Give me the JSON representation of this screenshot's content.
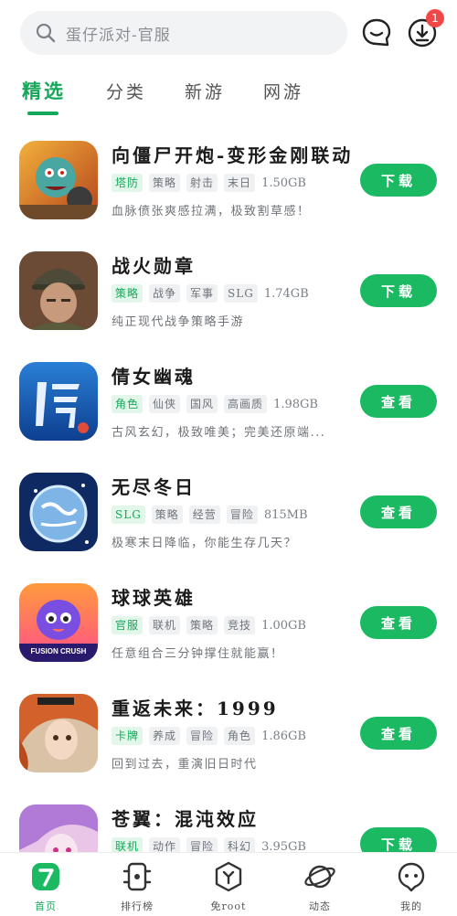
{
  "search": {
    "placeholder": "蛋仔派对-官服"
  },
  "header": {
    "download_badge": "1"
  },
  "tabs": [
    {
      "label": "精选",
      "active": true
    },
    {
      "label": "分类",
      "active": false
    },
    {
      "label": "新游",
      "active": false
    },
    {
      "label": "网游",
      "active": false
    }
  ],
  "games": [
    {
      "name": "向僵尸开炮-变形金刚联动",
      "tags": [
        "塔防",
        "策略",
        "射击",
        "末日"
      ],
      "size": "1.50GB",
      "desc": "血脉偾张爽感拉满，极致割草感！",
      "button": "下载"
    },
    {
      "name": "战火勋章",
      "tags": [
        "策略",
        "战争",
        "军事",
        "SLG"
      ],
      "size": "1.74GB",
      "desc": "纯正现代战争策略手游",
      "button": "下载"
    },
    {
      "name": "倩女幽魂",
      "tags": [
        "角色",
        "仙侠",
        "国风",
        "高画质"
      ],
      "size": "1.98GB",
      "desc": "古风玄幻，极致唯美；完美还原端...",
      "button": "查看"
    },
    {
      "name": "无尽冬日",
      "tags": [
        "SLG",
        "策略",
        "经营",
        "冒险"
      ],
      "size": "815MB",
      "desc": "极寒末日降临，你能生存几天？",
      "button": "查看"
    },
    {
      "name": "球球英雄",
      "tags": [
        "官服",
        "联机",
        "策略",
        "竞技"
      ],
      "size": "1.00GB",
      "desc": "任意组合三分钟撑住就能赢！",
      "button": "查看",
      "thumb_text": "FUSION CRUSH"
    },
    {
      "name": "重返未来：1999",
      "tags": [
        "卡牌",
        "养成",
        "冒险",
        "角色"
      ],
      "size": "1.86GB",
      "desc": "回到过去，重演旧日时代",
      "button": "查看"
    },
    {
      "name": "苍翼：混沌效应",
      "tags": [
        "联机",
        "动作",
        "冒险",
        "科幻"
      ],
      "size": "3.95GB",
      "desc": "",
      "button": "下载"
    }
  ],
  "bottom_nav": [
    {
      "label": "首页",
      "icon": "home-icon",
      "active": true
    },
    {
      "label": "排行榜",
      "icon": "ranking-icon",
      "active": false
    },
    {
      "label": "免root",
      "icon": "no-root-icon",
      "active": false
    },
    {
      "label": "动态",
      "icon": "planet-icon",
      "active": false
    },
    {
      "label": "我的",
      "icon": "profile-icon",
      "active": false
    }
  ],
  "colors": {
    "accent": "#1cb963",
    "accent_text": "#15a85a",
    "badge": "#f04848"
  }
}
